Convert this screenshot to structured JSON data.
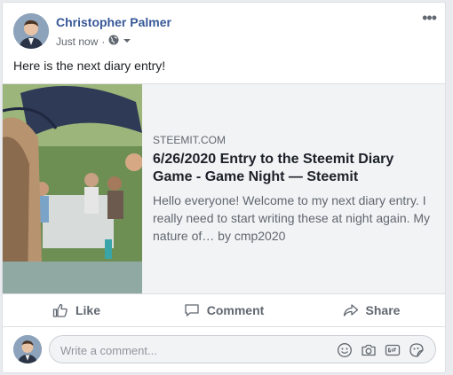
{
  "post": {
    "author": "Christopher Palmer",
    "timestamp": "Just now",
    "separator": "·",
    "audience_icon": "globe-icon",
    "text": "Here is the next diary entry!"
  },
  "link_preview": {
    "domain": "STEEMIT.COM",
    "title": "6/26/2020 Entry to the Steemit Diary Game - Game Night — Steemit",
    "description": "Hello everyone! Welcome to my next diary entry. I really need to start writing these at night again. My nature of… by cmp2020"
  },
  "actions": {
    "like": "Like",
    "comment": "Comment",
    "share": "Share"
  },
  "comment_box": {
    "placeholder": "Write a comment...",
    "icons": [
      "emoji-icon",
      "camera-icon",
      "gif-icon",
      "sticker-icon"
    ]
  },
  "colors": {
    "author": "#385898",
    "muted": "#606770",
    "border": "#dddfe2",
    "preview_bg": "#f2f3f5"
  }
}
